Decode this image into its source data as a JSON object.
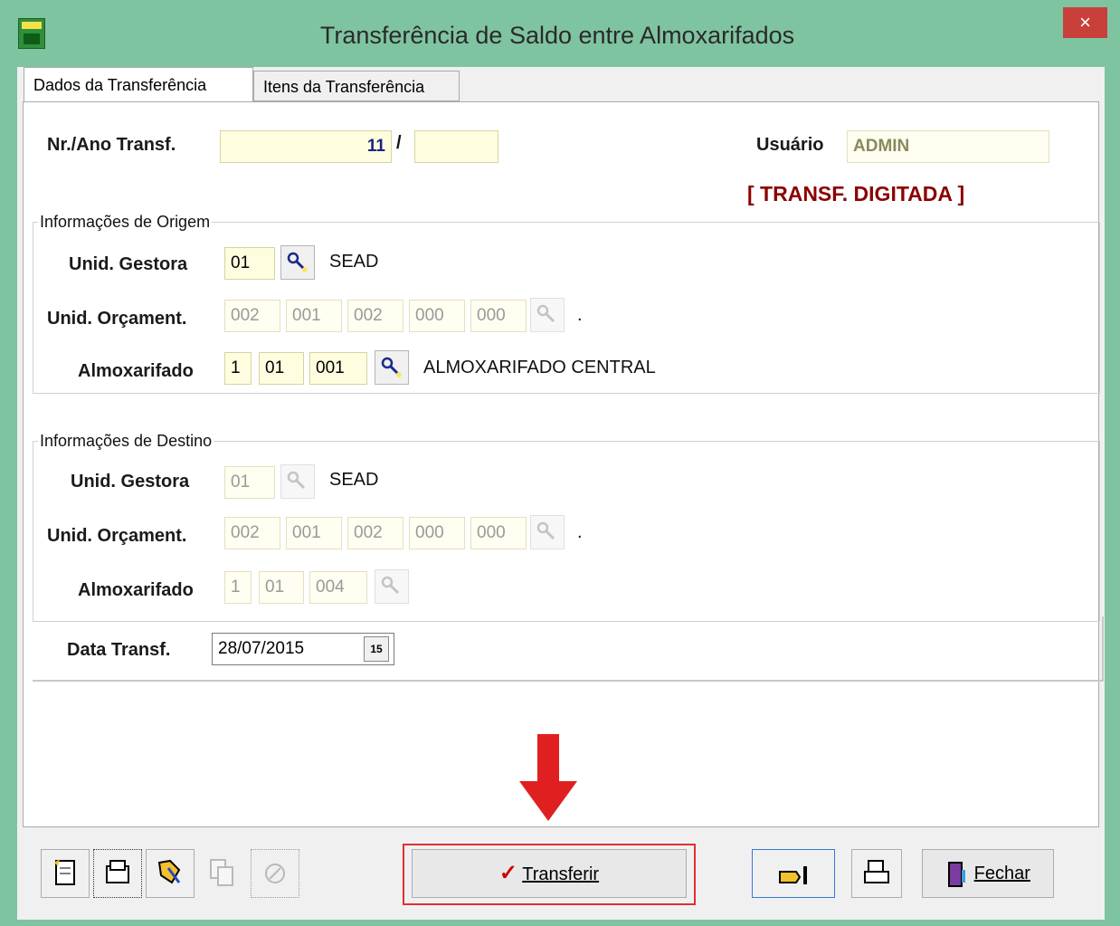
{
  "window": {
    "title": "Transferência de Saldo entre Almoxarifados",
    "close_glyph": "×"
  },
  "tabs": [
    {
      "label": "Dados da Transferência",
      "active": true
    },
    {
      "label": "Itens da Transferência",
      "active": false
    }
  ],
  "header": {
    "nr_ano_label": "Nr./Ano Transf.",
    "nr_value": "11",
    "slash": "/",
    "ano_value": "",
    "usuario_label": "Usuário",
    "usuario_value": "ADMIN",
    "status": "[ TRANSF. DIGITADA ]"
  },
  "origem": {
    "group_title": "Informações de Origem",
    "unid_gestora_label": "Unid. Gestora",
    "unid_gestora_value": "01",
    "unid_gestora_name": "SEAD",
    "unid_orcament_label": "Unid. Orçament.",
    "unid_orcament_values": [
      "002",
      "001",
      "002",
      "000",
      "000"
    ],
    "unid_orcament_name": ".",
    "almoxarifado_label": "Almoxarifado",
    "almoxarifado_values": [
      "1",
      "01",
      "001"
    ],
    "almoxarifado_name": "ALMOXARIFADO CENTRAL"
  },
  "destino": {
    "group_title": "Informações de Destino",
    "unid_gestora_label": "Unid. Gestora",
    "unid_gestora_value": "01",
    "unid_gestora_name": "SEAD",
    "unid_orcament_label": "Unid. Orçament.",
    "unid_orcament_values": [
      "002",
      "001",
      "002",
      "000",
      "000"
    ],
    "unid_orcament_name": ".",
    "almoxarifado_label": "Almoxarifado",
    "almoxarifado_values": [
      "1",
      "01",
      "004"
    ]
  },
  "data_transf": {
    "label": "Data Transf.",
    "value": "28/07/2015",
    "calendar_glyph": "15"
  },
  "toolbar": {
    "transferir_label": "Transferir",
    "fechar_label": "Fechar",
    "icons": [
      "new-document-icon",
      "open-folder-icon",
      "edit-icon",
      "copy-icon",
      "cancel-icon",
      "pointer-icon",
      "print-icon",
      "exit-door-icon"
    ]
  },
  "colors": {
    "status": "#8b0000",
    "accent_arrow": "#e02020",
    "window_frame": "#7fc4a0"
  }
}
